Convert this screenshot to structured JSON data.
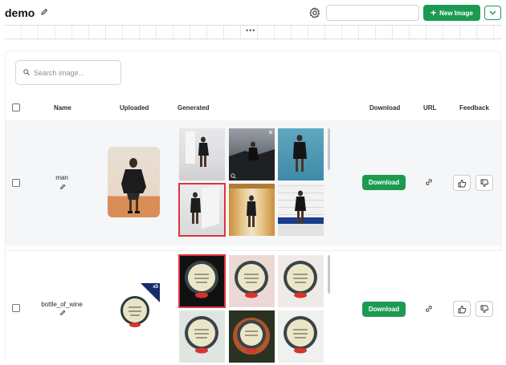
{
  "header": {
    "title": "demo",
    "new_image_label": "New Image",
    "band_dots": "•••"
  },
  "search": {
    "placeholder": "Search image..."
  },
  "table": {
    "columns": {
      "name": "Name",
      "uploaded": "Uploaded",
      "generated": "Generated",
      "download": "Download",
      "url": "URL",
      "feedback": "Feedback"
    },
    "rows": [
      {
        "name": "man",
        "download_label": "Download",
        "badge": "",
        "selected_index": 3
      },
      {
        "name": "bottle_of_wine",
        "download_label": "Download",
        "badge": "x5",
        "selected_index": 0
      }
    ]
  },
  "colors": {
    "accent": "#1d9a52",
    "selected_border": "#e0343e",
    "badge": "#1a2a6b"
  },
  "icons": [
    "pencil-icon",
    "gear-icon",
    "plus-icon",
    "chevron-down-icon",
    "search-icon",
    "link-icon",
    "thumbs-up-icon",
    "thumbs-down-icon",
    "close-icon",
    "search-overlay-icon"
  ]
}
